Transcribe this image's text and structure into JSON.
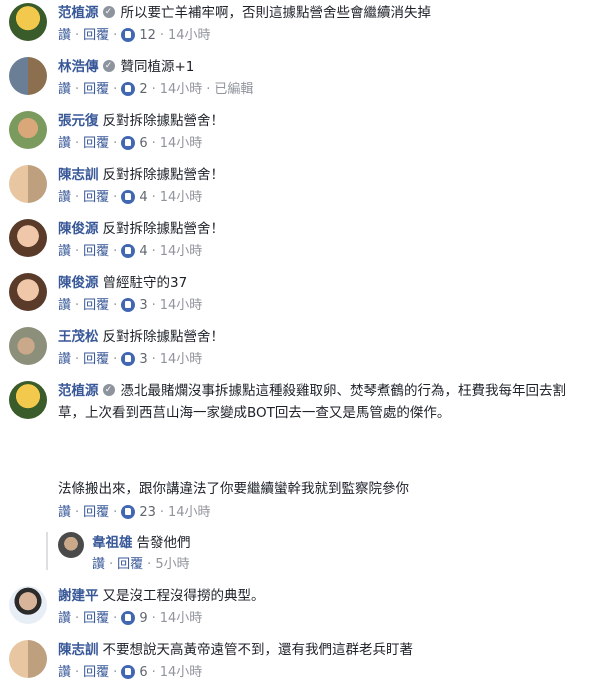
{
  "ui": {
    "like_label": "讚",
    "reply_label": "回覆",
    "separator": "·",
    "badge_glyph": "✓"
  },
  "comments": [
    {
      "name": "范植源",
      "verified": true,
      "text": "所以要亡羊補牢啊，否則這據點營舍些會繼續消失掉",
      "likes": "12",
      "time": "14小時"
    },
    {
      "name": "林浩傳",
      "verified": true,
      "text": "贊同植源+1",
      "likes": "2",
      "time": "14小時",
      "edited": "已編輯"
    },
    {
      "name": "張元復",
      "verified": false,
      "text": "反對拆除據點營舍！",
      "likes": "6",
      "time": "14小時"
    },
    {
      "name": "陳志訓",
      "verified": false,
      "text": "反對拆除據點營舍！",
      "likes": "4",
      "time": "14小時"
    },
    {
      "name": "陳俊源",
      "verified": false,
      "text": "反對拆除據點營舍！",
      "likes": "4",
      "time": "14小時"
    },
    {
      "name": "陳俊源",
      "verified": false,
      "text": "曾經駐守的37",
      "likes": "3",
      "time": "14小時"
    },
    {
      "name": "王茂松",
      "verified": false,
      "text": "反對拆除據點營舍！",
      "likes": "3",
      "time": "14小時"
    },
    {
      "name": "范植源",
      "verified": true,
      "text": "憑北最賭爛沒事拆據點這種殺雞取卵、焚琴煮鶴的行為，枉費我每年回去割草，上次看到西莒山海一家變成BOT回去一查又是馬管處的傑作。",
      "text2": "法條搬出來，跟你講違法了你要繼續蠻幹我就到監察院參你",
      "likes": "23",
      "time": "14小時"
    },
    {
      "name": "韋祖雄",
      "verified": false,
      "text": "告發他們",
      "likes": "",
      "time": "5小時"
    },
    {
      "name": "謝建平",
      "verified": false,
      "text": "又是沒工程沒得撈的典型。",
      "likes": "9",
      "time": "14小時"
    },
    {
      "name": "陳志訓",
      "verified": false,
      "text": "不要想說天高黃帝遠管不到，還有我們這群老兵盯著",
      "likes": "6",
      "time": "14小時"
    }
  ]
}
